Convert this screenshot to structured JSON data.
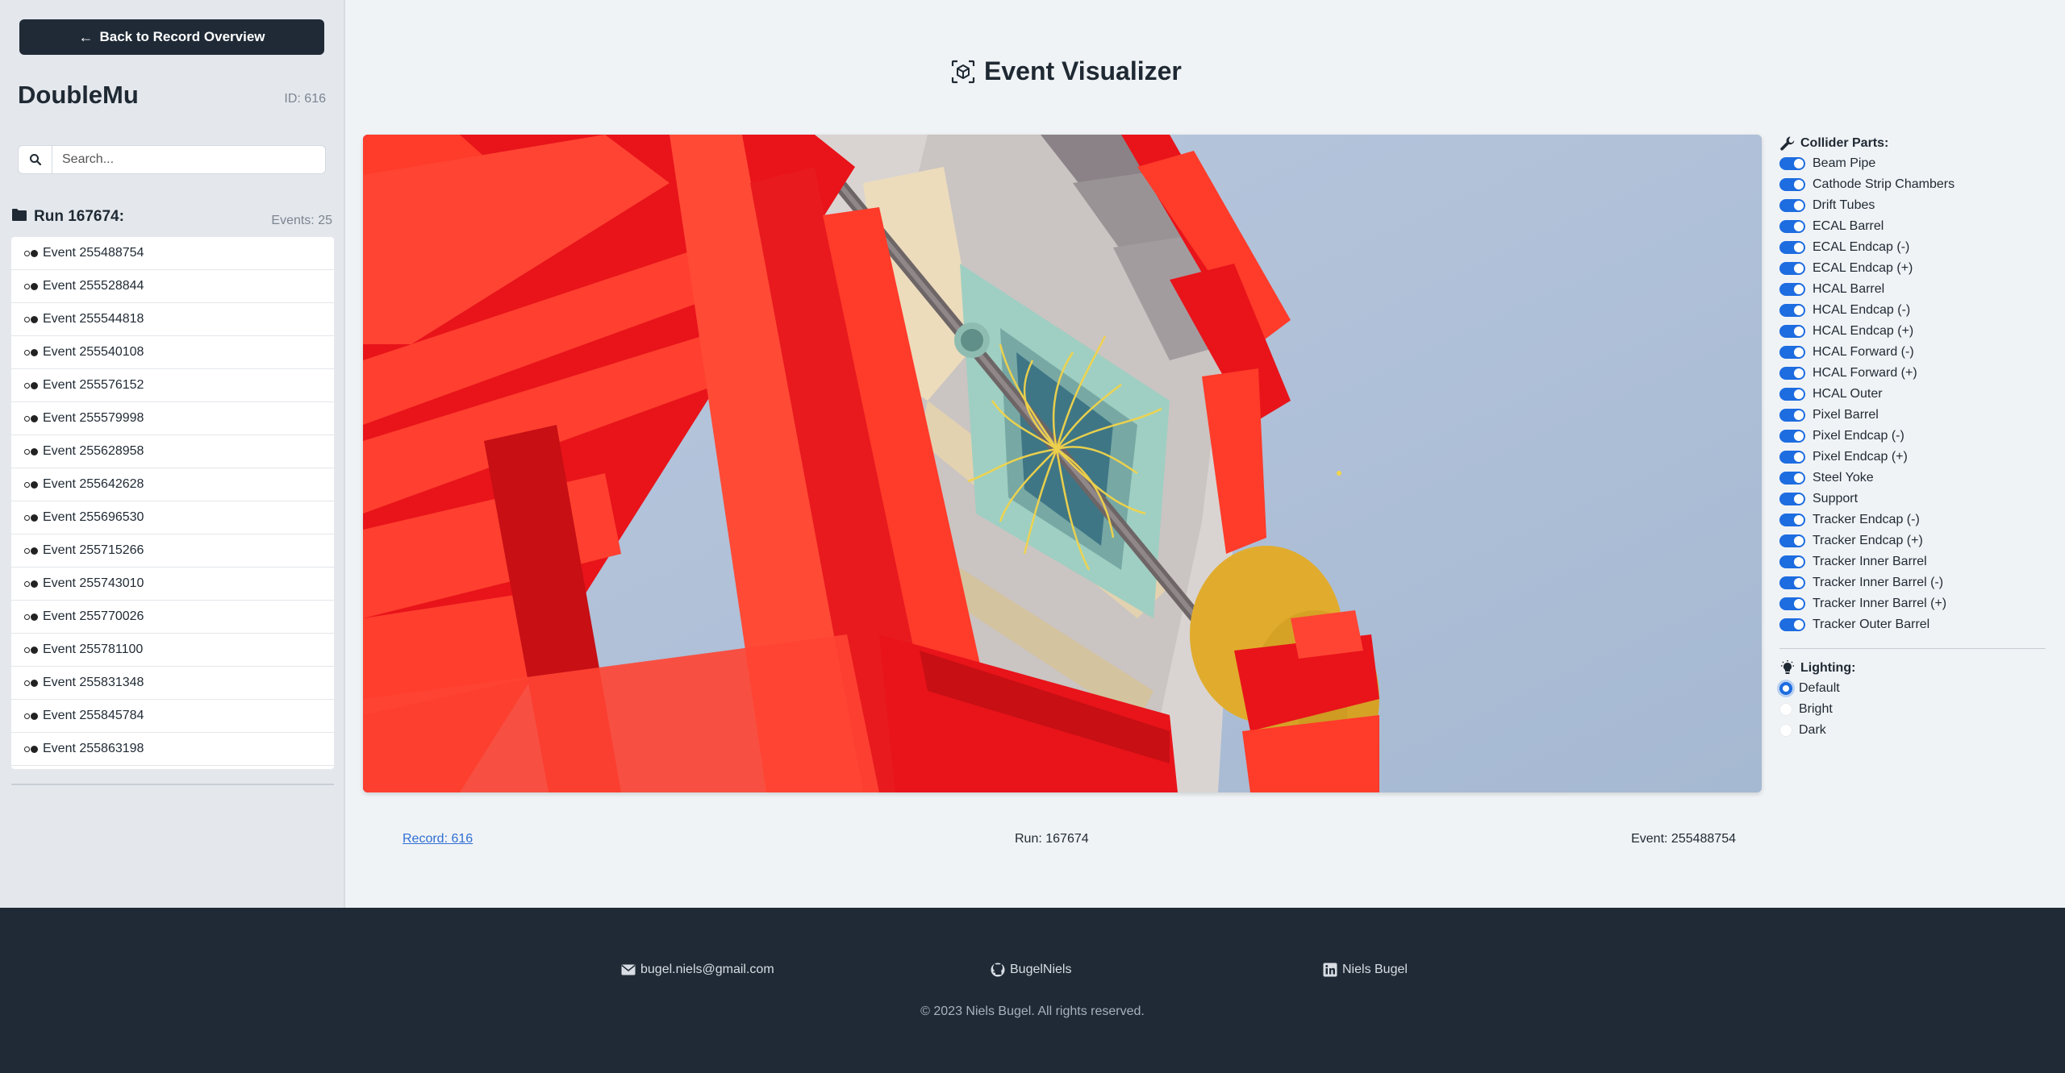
{
  "sidebar": {
    "back_label": "Back to Record Overview",
    "title": "DoubleMu",
    "record_id": "ID: 616",
    "search_placeholder": "Search...",
    "run_title": "Run 167674:",
    "events_count": "Events: 25",
    "events": [
      "Event 255488754",
      "Event 255528844",
      "Event 255544818",
      "Event 255540108",
      "Event 255576152",
      "Event 255579998",
      "Event 255628958",
      "Event 255642628",
      "Event 255696530",
      "Event 255715266",
      "Event 255743010",
      "Event 255770026",
      "Event 255781100",
      "Event 255831348",
      "Event 255845784",
      "Event 255863198"
    ]
  },
  "main": {
    "title": "Event Visualizer",
    "record_link": "Record: 616",
    "run_label": "Run: 167674",
    "event_label": "Event: 255488754"
  },
  "controls": {
    "parts_heading": "Collider Parts:",
    "parts": [
      "Beam Pipe",
      "Cathode Strip Chambers",
      "Drift Tubes",
      "ECAL Barrel",
      "ECAL Endcap (-)",
      "ECAL Endcap (+)",
      "HCAL Barrel",
      "HCAL Endcap (-)",
      "HCAL Endcap (+)",
      "HCAL Forward (-)",
      "HCAL Forward (+)",
      "HCAL Outer",
      "Pixel Barrel",
      "Pixel Endcap (-)",
      "Pixel Endcap (+)",
      "Steel Yoke",
      "Support",
      "Tracker Endcap (-)",
      "Tracker Endcap (+)",
      "Tracker Inner Barrel",
      "Tracker Inner Barrel (-)",
      "Tracker Inner Barrel (+)",
      "Tracker Outer Barrel"
    ],
    "lighting_heading": "Lighting:",
    "lighting_options": [
      "Default",
      "Bright",
      "Dark"
    ],
    "lighting_selected": "Default"
  },
  "footer": {
    "email": "bugel.niels@gmail.com",
    "github": "BugelNiels",
    "linkedin": "Niels Bugel",
    "copyright": "© 2023 Niels Bugel. All rights reserved."
  },
  "colors": {
    "accent": "#1d6ce0",
    "dark": "#1f2a36",
    "detector_red": "#e8141a",
    "track_yellow": "#f2d44a"
  }
}
